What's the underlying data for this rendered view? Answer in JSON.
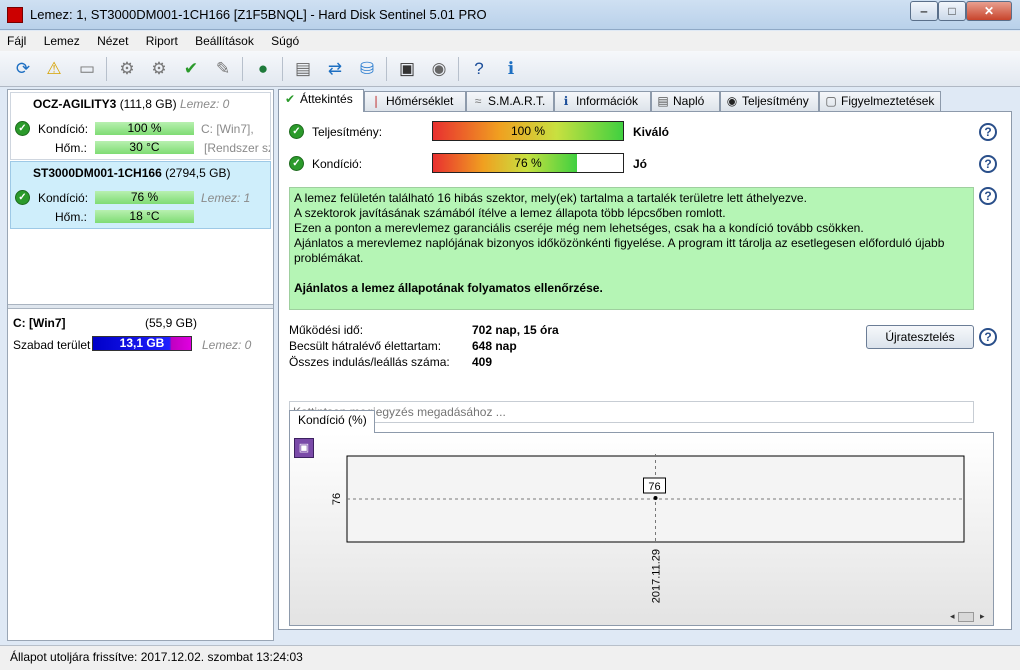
{
  "window": {
    "title": "Lemez: 1, ST3000DM001-1CH166 [Z1F5BNQL]  -  Hard Disk Sentinel 5.01 PRO",
    "minimize_label": "‒",
    "maximize_label": "□",
    "close_label": "✕"
  },
  "menu": {
    "items": [
      "Fájl",
      "Lemez",
      "Nézet",
      "Riport",
      "Beállítások",
      "Súgó"
    ]
  },
  "toolbar": {
    "icons": [
      "refresh-icon",
      "alert-icon",
      "disk-icon",
      "disk-tool-icon",
      "disk-tool-2-icon",
      "disk-check-icon",
      "disk-wrench-icon",
      "globe-icon",
      "document-icon",
      "sync-icon",
      "network-icon",
      "monitor-icon",
      "speaker-icon",
      "help-icon",
      "info-icon"
    ]
  },
  "left": {
    "disks": [
      {
        "name": "OCZ-AGILITY3",
        "size": "(111,8 GB)",
        "lemez": "Lemez: 0",
        "cond_label": "Kondíció:",
        "cond_value": "100 %",
        "temp_label": "Hőm.:",
        "temp_value": "30 °C",
        "side1": "C: [Win7],",
        "side2": "[Rendszer szá"
      },
      {
        "name": "ST3000DM001-1CH166",
        "size": "(2794,5 GB)",
        "lemez": "Lemez: 1",
        "cond_label": "Kondíció:",
        "cond_value": "76 %",
        "temp_label": "Hőm.:",
        "temp_value": "18 °C"
      }
    ],
    "drive": {
      "name": "C: [Win7]",
      "size": "(55,9 GB)",
      "free_label": "Szabad terület",
      "free_value": "13,1 GB",
      "lemez": "Lemez: 0"
    }
  },
  "tabs": [
    {
      "label": "Áttekintés",
      "icon": "check-icon",
      "active": true
    },
    {
      "label": "Hőmérséklet",
      "icon": "thermometer-icon"
    },
    {
      "label": "S.M.A.R.T.",
      "icon": "smart-icon"
    },
    {
      "label": "Információk",
      "icon": "info-icon"
    },
    {
      "label": "Napló",
      "icon": "log-icon"
    },
    {
      "label": "Teljesítmény",
      "icon": "gauge-icon"
    },
    {
      "label": "Figyelmeztetések",
      "icon": "warning-doc-icon"
    }
  ],
  "overview": {
    "performance_label": "Teljesítmény:",
    "performance_value": "100 %",
    "performance_pct": 100,
    "performance_rating": "Kiváló",
    "health_label": "Kondíció:",
    "health_value": "76 %",
    "health_pct": 76,
    "health_rating": "Jó",
    "message_lines": [
      "A lemez felületén található 16 hibás szektor, mely(ek) tartalma a tartalék területre lett áthelyezve.",
      "A szektorok javításának számából ítélve a lemez állapota több lépcsőben romlott.",
      "Ezen a ponton a merevlemez garanciális cseréje még nem lehetséges, csak ha a kondíció tovább csökken.",
      "Ajánlatos a merevlemez naplójának bizonyos időközönkénti figyelése. A program itt tárolja az esetlegesen előforduló újabb problémákat."
    ],
    "message_strong": "Ajánlatos a lemez állapotának folyamatos ellenőrzése.",
    "power_on_label": "Működési idő:",
    "power_on_value": "702 nap, 15 óra",
    "remaining_label": "Becsült hátralévő élettartam:",
    "remaining_value": "648 nap",
    "startstop_label": "Összes indulás/leállás száma:",
    "startstop_value": "409",
    "retest_label": "Újratesztelés",
    "note_placeholder": "Kattintson megjegyzés megadásához ...",
    "chart_tab_label": "Kondíció  (%)"
  },
  "chart_data": {
    "type": "line",
    "x": [
      "2017.11.29"
    ],
    "series": [
      {
        "values": [
          76
        ]
      }
    ],
    "data_labels": [
      "76"
    ],
    "y_tick_labels": [
      "76"
    ],
    "x_tick_labels": [
      "2017.11.29"
    ]
  },
  "status": {
    "text": "Állapot utoljára frissítve: 2017.12.02. szombat 13:24:03"
  }
}
